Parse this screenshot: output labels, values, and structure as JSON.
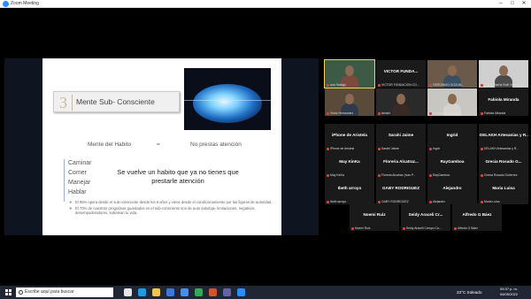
{
  "window": {
    "title": "Zoom Meeting",
    "controls": [
      "─",
      "□",
      "✕"
    ]
  },
  "slide": {
    "header_number": "3",
    "header_text": "Mente Sub- Consciente",
    "habit_left": "Mente del Habito",
    "habit_eq": "=",
    "habit_right": "No prestas atención",
    "verbs": [
      "Caminar",
      "Comer",
      "Manejar",
      "Hablar"
    ],
    "big_text": "Se vuelve un habito que ya no tienes que prestarle atención",
    "bullets": [
      "El 95% opera desde el sub-consciente desde los 8 años y viene desde el condicionamiento por las figuras de autoridad.",
      "El 70% de nuestros programas guardados en el sub-consciente son de auto sabotaje, limitaciones, negativos, desempoderadores, sabotean tu vida."
    ]
  },
  "gallery": {
    "tiles": [
      {
        "name": "",
        "tag": "ana Hidalgo",
        "video": true,
        "active": true
      },
      {
        "name": "VICTOR FUNDA...",
        "tag": "VICTOR FUNDACION CO...",
        "video": false
      },
      {
        "name": "",
        "tag": "GERONIMO GOZUM...",
        "video": true
      },
      {
        "name": "",
        "tag": "Valeria Barba Ruth Yoves Vaz...",
        "video": true
      },
      {
        "name": "",
        "tag": "Victor Hernandez",
        "video": true
      },
      {
        "name": "",
        "tag": "ismael",
        "video": true
      },
      {
        "name": "",
        "tag": "Fundación Cozumel",
        "video": true
      },
      {
        "name": "Fabiola Miranda",
        "tag": "Fabiola Miranda",
        "video": false
      },
      {
        "name": "iPhone de Aristela",
        "tag": "iPhone de Aristela",
        "video": false
      },
      {
        "name": "Sarahi Jaime",
        "tag": "Sarahi Jaime",
        "video": false
      },
      {
        "name": "Ingrid",
        "tag": "Ingrid",
        "video": false
      },
      {
        "name": "DELAKH Artesanias y R...",
        "tag": "DELAKH Artesanias y R...",
        "video": false
      },
      {
        "name": "May KinKa",
        "tag": "May KinKa",
        "video": false
      },
      {
        "name": "Floreria Alcatraz...",
        "tag": "Floreria Alcatraz (Ivan P...",
        "video": false
      },
      {
        "name": "RayGamboa",
        "tag": "RayGamboa",
        "video": false
      },
      {
        "name": "Grecia Rosado G...",
        "tag": "Grecia Rosado Gutierrez",
        "video": false
      },
      {
        "name": "Ibeth arroyo",
        "tag": "Ibeth arroyo",
        "video": false
      },
      {
        "name": "GABY RODRIGUEZ",
        "tag": "GABY RODRIGUEZ",
        "video": false
      },
      {
        "name": "Alejandro",
        "tag": "Alejandro",
        "video": false
      },
      {
        "name": "Maria Luisa",
        "tag": "Maria Luisa",
        "video": false
      },
      {
        "name": "Noemi Ruiz",
        "tag": "Noemi Ruiz",
        "video": false
      },
      {
        "name": "Seidy Araceli Cr...",
        "tag": "Seidy Araceli Crespo Ca...",
        "video": false
      },
      {
        "name": "Alfredo G Báez",
        "tag": "Alfredo G Báez",
        "video": false
      }
    ]
  },
  "taskbar": {
    "search_placeholder": "Escribe aquí para buscar",
    "weather": "23°C Soleado",
    "time": "09:37 p. m.",
    "date": "06/05/2022",
    "apps": [
      {
        "icon": "task-view-icon",
        "color": "#e6e6e6"
      },
      {
        "icon": "edge-icon",
        "color": "#1b9de2"
      },
      {
        "icon": "file-explorer-icon",
        "color": "#f3c34a"
      },
      {
        "icon": "mail-icon",
        "color": "#3b79d8"
      },
      {
        "icon": "store-icon",
        "color": "#4a8fe0"
      },
      {
        "icon": "chrome-icon",
        "color": "#3aa757"
      },
      {
        "icon": "powerpoint-icon",
        "color": "#d35230"
      },
      {
        "icon": "teams-icon",
        "color": "#6264a7"
      },
      {
        "icon": "zoom-icon",
        "color": "#2d8cff"
      }
    ]
  }
}
